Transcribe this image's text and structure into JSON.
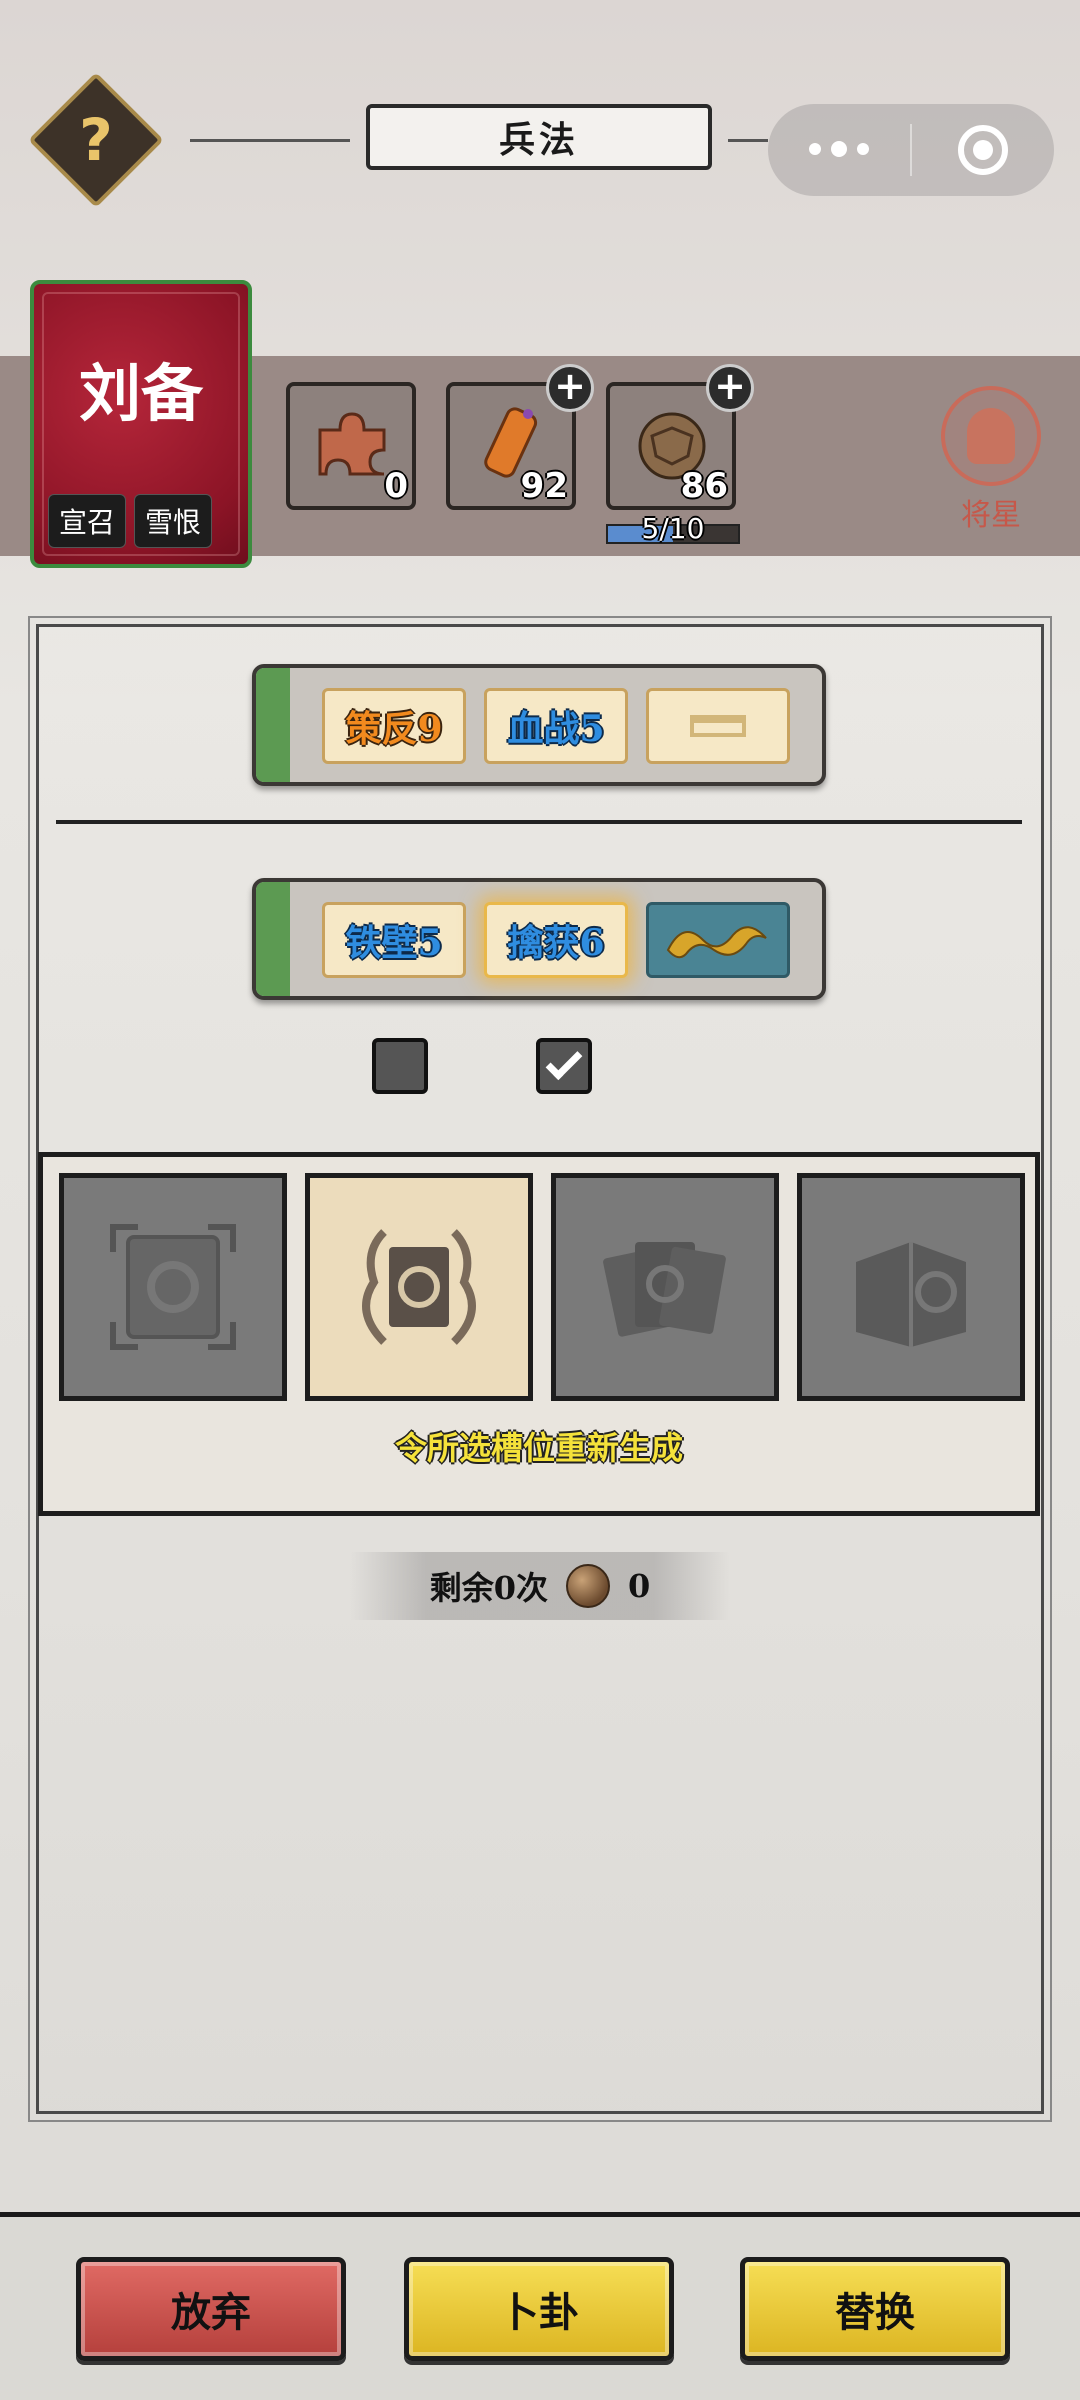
{
  "header": {
    "title": "兵法"
  },
  "hero": {
    "name": "刘备",
    "tags": [
      "宣召",
      "雪恨"
    ]
  },
  "resources": [
    {
      "icon": "puzzle-fragment-icon",
      "count": "0",
      "has_plus": false
    },
    {
      "icon": "scroll-token-icon",
      "count": "92",
      "has_plus": true
    },
    {
      "icon": "bronze-orb-icon",
      "count": "86",
      "has_plus": true
    }
  ],
  "progress": {
    "label": "5/10",
    "value": 0.5
  },
  "general_star": {
    "label": "将星"
  },
  "row1": {
    "slots": [
      {
        "label": "策反9",
        "color": "orange"
      },
      {
        "label": "血战5",
        "color": "blue"
      },
      {
        "label": "",
        "state": "empty"
      }
    ]
  },
  "row2": {
    "slots": [
      {
        "label": "铁壁5",
        "color": "blue"
      },
      {
        "label": "擒获6",
        "color": "blue",
        "selected": true
      },
      {
        "label": "",
        "state": "dragon"
      }
    ]
  },
  "checkboxes": [
    {
      "checked": false
    },
    {
      "checked": true
    }
  ],
  "function": {
    "cards": [
      {
        "icon": "refresh-book-icon",
        "active": false
      },
      {
        "icon": "regenerate-book-icon",
        "active": true
      },
      {
        "icon": "multi-book-icon",
        "active": false
      },
      {
        "icon": "level-book-icon",
        "active": false
      }
    ],
    "description": "令所选槽位重新生成"
  },
  "remaining": {
    "label": "剩余0次",
    "count": "0"
  },
  "buttons": {
    "abandon": "放弃",
    "divine": "卜卦",
    "replace": "替换"
  },
  "colors": {
    "hero_card": "#8c1426",
    "accent_gold": "#dcb522",
    "abandon_red": "#b5403c"
  }
}
